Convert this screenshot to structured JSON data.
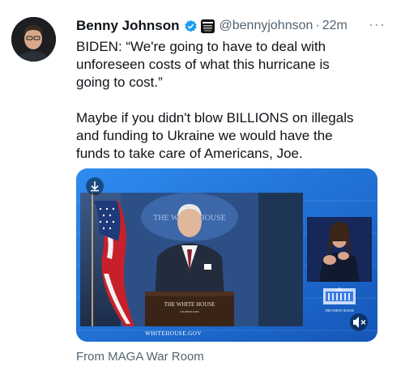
{
  "author": {
    "display_name": "Benny Johnson",
    "handle": "@bennyjohnson",
    "separator": "·",
    "time": "22m",
    "verified_icon": "verified-badge-icon",
    "affiliation_icon": "affiliation-badge-icon"
  },
  "tweet": {
    "paragraph1": [
      "BIDEN: “We're going to have to deal with",
      "unforeseen costs of what this hurricane is",
      "going to cost.”"
    ],
    "paragraph2": [
      "Maybe if you didn't blow BILLIONS on illegals",
      "and funding to Ukraine we would have the",
      "funds to take care of Americans, Joe."
    ]
  },
  "media": {
    "podium_sign": "THE WHITE HOUSE",
    "podium_subtext": "WASHINGTON",
    "backdrop_text": "THE WHITE HOUSE",
    "watermark": "WHITEHOUSE.GOV",
    "logo_text": "THE WHITE HOUSE",
    "download_icon": "download-icon",
    "mute_icon": "muted-speaker-icon"
  },
  "source_label": "From MAGA War Room",
  "colors": {
    "text_primary": "#0f1419",
    "text_secondary": "#536471",
    "verified_blue": "#1d9bf0",
    "media_blue": "#1a6fd1"
  }
}
